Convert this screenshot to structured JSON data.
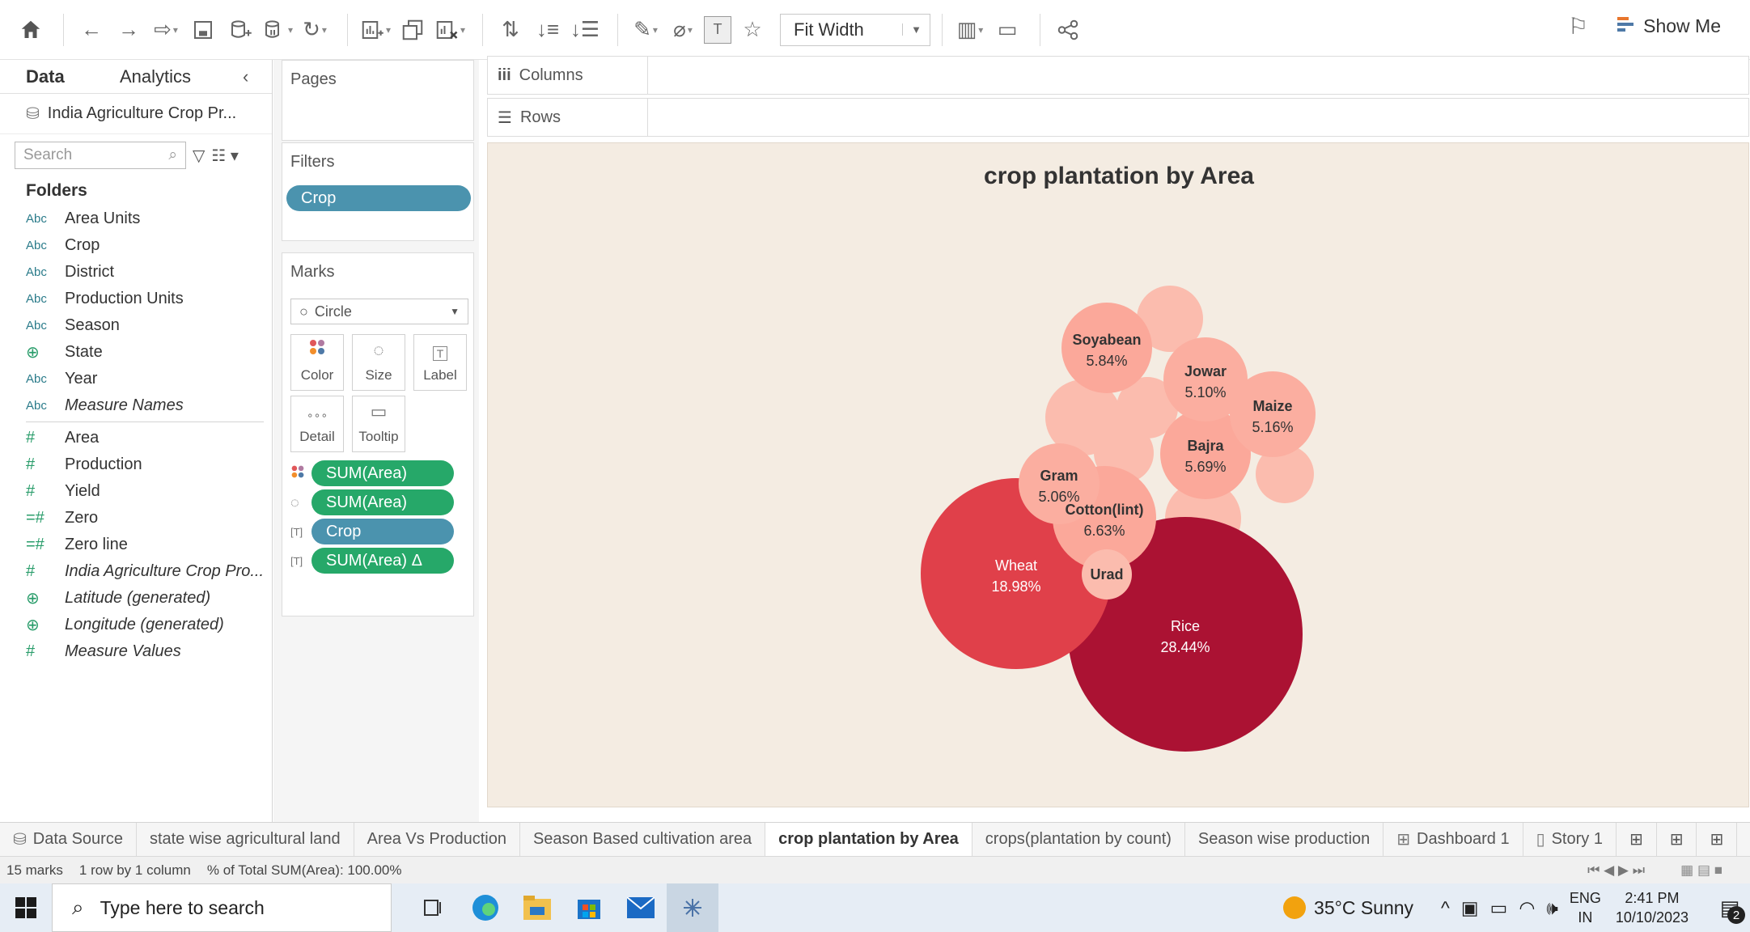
{
  "toolbar": {
    "fit_label": "Fit Width",
    "show_me_label": "Show Me"
  },
  "data_pane": {
    "tab_data": "Data",
    "tab_analytics": "Analytics",
    "datasource": "India Agriculture Crop Pr...",
    "search_placeholder": "Search",
    "folders_heading": "Folders",
    "dimensions": [
      {
        "type": "Abc",
        "name": "Area Units"
      },
      {
        "type": "Abc",
        "name": "Crop"
      },
      {
        "type": "Abc",
        "name": "District"
      },
      {
        "type": "Abc",
        "name": "Production Units"
      },
      {
        "type": "Abc",
        "name": "Season"
      },
      {
        "type": "geo",
        "name": "State"
      },
      {
        "type": "Abc",
        "name": "Year"
      },
      {
        "type": "Abc",
        "name": "Measure Names"
      }
    ],
    "measures": [
      {
        "type": "#",
        "name": "Area"
      },
      {
        "type": "#",
        "name": "Production"
      },
      {
        "type": "#",
        "name": "Yield"
      },
      {
        "type": "=#",
        "name": "Zero"
      },
      {
        "type": "=#",
        "name": "Zero line"
      },
      {
        "type": "#",
        "name": "India Agriculture Crop Pro..."
      },
      {
        "type": "geo",
        "name": "Latitude (generated)"
      },
      {
        "type": "geo",
        "name": "Longitude (generated)"
      },
      {
        "type": "#",
        "name": "Measure Values"
      }
    ]
  },
  "shelves": {
    "pages_label": "Pages",
    "filters_label": "Filters",
    "filter_pill": "Crop",
    "marks_label": "Marks",
    "mark_type": "Circle",
    "mark_buttons": [
      "Color",
      "Size",
      "Label",
      "Detail",
      "Tooltip"
    ],
    "mark_pills": [
      {
        "label": "SUM(Area)",
        "kind": "color"
      },
      {
        "label": "SUM(Area)",
        "kind": "size"
      },
      {
        "label": "Crop",
        "kind": "label"
      },
      {
        "label": "SUM(Area)  Δ",
        "kind": "label"
      }
    ],
    "columns_label": "Columns",
    "rows_label": "Rows"
  },
  "chart_data": {
    "type": "packed-bubble",
    "title": "crop plantation by Area",
    "measure": "% of Total SUM(Area)",
    "bubbles": [
      {
        "label": "Rice",
        "value": "28.44%",
        "color": "#ab1233"
      },
      {
        "label": "Wheat",
        "value": "18.98%",
        "color": "#e0404a"
      },
      {
        "label": "Cotton(lint)",
        "value": "6.63%",
        "color": "#fba89a"
      },
      {
        "label": "Soyabean",
        "value": "5.84%",
        "color": "#fba89a"
      },
      {
        "label": "Bajra",
        "value": "5.69%",
        "color": "#fba89a"
      },
      {
        "label": "Maize",
        "value": "5.16%",
        "color": "#fbaea0"
      },
      {
        "label": "Jowar",
        "value": "5.10%",
        "color": "#fbaea0"
      },
      {
        "label": "Gram",
        "value": "5.06%",
        "color": "#fbaea0"
      },
      {
        "label": "Urad",
        "value": "",
        "color": "#fbbcae"
      }
    ],
    "unlabeled_bubble_color": "#fbbcae"
  },
  "sheet_tabs": [
    {
      "label": "Data Source",
      "icon": "database-icon"
    },
    {
      "label": "state wise agricultural land"
    },
    {
      "label": "Area Vs Production"
    },
    {
      "label": "Season Based cultivation area"
    },
    {
      "label": "crop plantation by Area",
      "active": true
    },
    {
      "label": "crops(plantation by count)"
    },
    {
      "label": "Season wise production"
    },
    {
      "label": "Dashboard 1",
      "icon": "dashboard-icon"
    },
    {
      "label": "Story 1",
      "icon": "story-icon"
    }
  ],
  "status": {
    "marks": "15 marks",
    "rows_cols": "1 row by 1 column",
    "sum": "% of Total SUM(Area): 100.00%"
  },
  "taskbar": {
    "search_placeholder": "Type here to search",
    "weather": "35°C  Sunny",
    "lang_top": "ENG",
    "lang_bottom": "IN",
    "time": "2:41 PM",
    "date": "10/10/2023",
    "notifications": "2"
  }
}
